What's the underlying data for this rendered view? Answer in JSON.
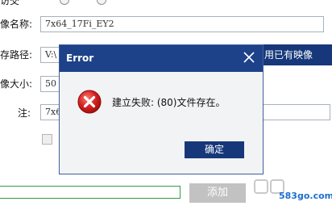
{
  "form": {
    "label_top": "访交",
    "label_name": "像名称:",
    "name_value": "7x64_17Fi_EY2",
    "label_path": "存路径:",
    "path_value": "V:\\",
    "label_size": "像大小:",
    "size_value": "50",
    "label_note": "注:",
    "note_value": "7x6",
    "use_existing_button": "用已有映像",
    "add_button": "添加"
  },
  "dialog": {
    "title": "Error",
    "message": "建立失败: (80)文件存在。",
    "ok_button": "确定"
  },
  "watermark": {
    "text": "583go.com"
  },
  "colors": {
    "dialog_title_bg": "#1e4289",
    "button_blue": "#16387a",
    "progress_green": "#2e9e45",
    "error_red": "#d52020",
    "add_button_gray": "#c2c2c2"
  }
}
